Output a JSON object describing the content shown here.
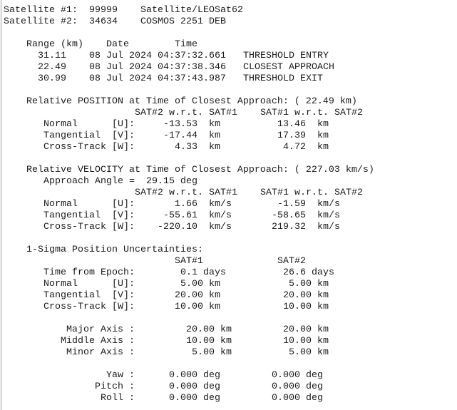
{
  "banner": "*********************************************************",
  "satellites": [
    {
      "label": "Satellite #1:",
      "id": "99999",
      "name": "Satellite/LEOSat62"
    },
    {
      "label": "Satellite #2:",
      "id": "34634",
      "name": "COSMOS 2251 DEB"
    }
  ],
  "events": {
    "headers": {
      "range": "Range (km)",
      "date": "Date",
      "time": "Time"
    },
    "rows": [
      {
        "range": "31.11",
        "datetime": "08 Jul 2024 04:37:32.661",
        "event": "THRESHOLD ENTRY"
      },
      {
        "range": "22.49",
        "datetime": "08 Jul 2024 04:37:38.346",
        "event": "CLOSEST APPROACH"
      },
      {
        "range": "30.99",
        "datetime": "08 Jul 2024 04:37:43.987",
        "event": "THRESHOLD EXIT"
      }
    ]
  },
  "position": {
    "title": "Relative POSITION at Time of Closest Approach: ( 22.49 km)",
    "col1_header": "SAT#2 w.r.t. SAT#1",
    "col2_header": "SAT#1 w.r.t. SAT#2",
    "unit": "km",
    "rows": [
      {
        "label": "Normal",
        "axis": "[U]:",
        "v1": "-13.53",
        "v2": "13.46"
      },
      {
        "label": "Tangential",
        "axis": "[V]:",
        "v1": "-17.44",
        "v2": "17.39"
      },
      {
        "label": "Cross-Track",
        "axis": "[W]:",
        "v1": "4.33",
        "v2": "4.72"
      }
    ]
  },
  "velocity": {
    "title": "Relative VELOCITY at Time of Closest Approach: ( 227.03 km/s)",
    "angle_label": "Approach Angle =",
    "angle_value": "29.15 deg",
    "col1_header": "SAT#2 w.r.t. SAT#1",
    "col2_header": "SAT#1 w.r.t. SAT#2",
    "unit": "km/s",
    "rows": [
      {
        "label": "Normal",
        "axis": "[U]:",
        "v1": "1.66",
        "v2": "-1.59"
      },
      {
        "label": "Tangential",
        "axis": "[V]:",
        "v1": "-55.61",
        "v2": "-58.65"
      },
      {
        "label": "Cross-Track",
        "axis": "[W]:",
        "v1": "-220.10",
        "v2": "219.32"
      }
    ]
  },
  "uncertainty": {
    "title": "1-Sigma Position Uncertainties:",
    "col1_header": "SAT#1",
    "col2_header": "SAT#2",
    "epoch": {
      "label": "Time from Epoch:",
      "v1": "0.1 days",
      "v2": "26.6 days"
    },
    "unit": "km",
    "rows": [
      {
        "label": "Normal",
        "axis": "[U]:",
        "v1": "5.00",
        "v2": "5.00"
      },
      {
        "label": "Tangential",
        "axis": "[V]:",
        "v1": "20.00",
        "v2": "20.00"
      },
      {
        "label": "Cross-Track",
        "axis": "[W]:",
        "v1": "10.00",
        "v2": "10.00"
      }
    ],
    "axes": [
      {
        "label": "Major Axis :",
        "v1": "20.00 km",
        "v2": "20.00 km"
      },
      {
        "label": "Middle Axis :",
        "v1": "10.00 km",
        "v2": "10.00 km"
      },
      {
        "label": "Minor Axis :",
        "v1": "5.00 km",
        "v2": "5.00 km"
      }
    ],
    "angles": [
      {
        "label": "Yaw :",
        "v1": "0.000 deg",
        "v2": "0.000 deg"
      },
      {
        "label": "Pitch :",
        "v1": "0.000 deg",
        "v2": "0.000 deg"
      },
      {
        "label": "Roll :",
        "v1": "0.000 deg",
        "v2": "0.000 deg"
      }
    ]
  }
}
